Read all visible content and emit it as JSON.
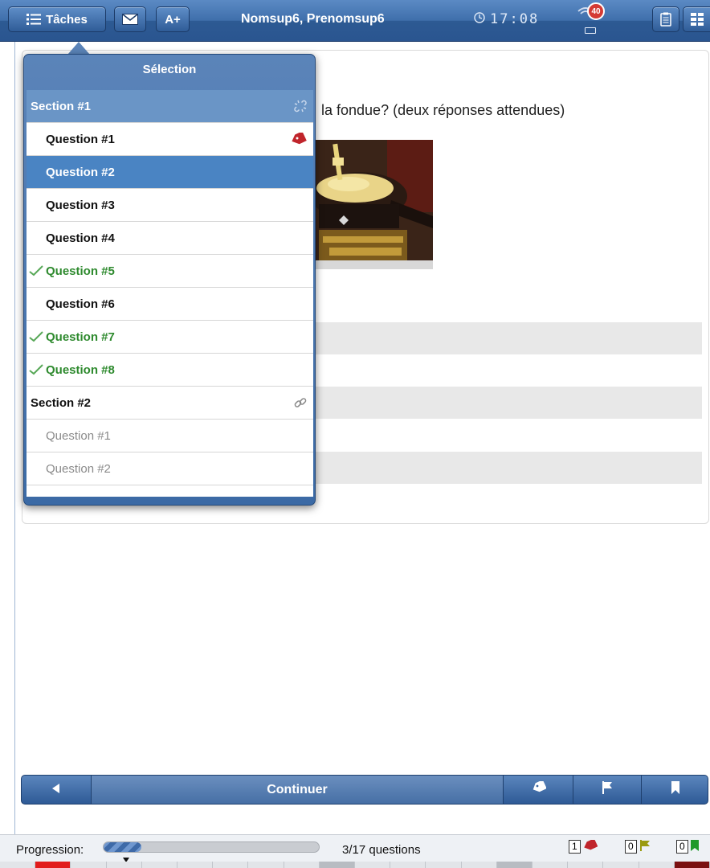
{
  "header": {
    "tasks_label": "Tâches",
    "font_button_label": "A+",
    "student_name": "Nomsup6, Prenomsup6",
    "time": "17:08",
    "notification_count": "40"
  },
  "question": {
    "text_visible": "la fondue? (deux réponses attendues)"
  },
  "selection_panel": {
    "title": "Sélection",
    "rows": [
      {
        "label": "Section #1",
        "kind": "section",
        "state": "current-section",
        "icon": "link-broken-icon"
      },
      {
        "label": "Question #1",
        "kind": "question",
        "state": "normal",
        "icon": "tag-icon"
      },
      {
        "label": "Question #2",
        "kind": "question",
        "state": "selected",
        "icon": ""
      },
      {
        "label": "Question #3",
        "kind": "question",
        "state": "normal",
        "icon": ""
      },
      {
        "label": "Question #4",
        "kind": "question",
        "state": "normal",
        "icon": ""
      },
      {
        "label": "Question #5",
        "kind": "question",
        "state": "done",
        "icon": "check-icon"
      },
      {
        "label": "Question #6",
        "kind": "question",
        "state": "normal",
        "icon": ""
      },
      {
        "label": "Question #7",
        "kind": "question",
        "state": "done",
        "icon": "check-icon"
      },
      {
        "label": "Question #8",
        "kind": "question",
        "state": "done",
        "icon": "check-icon"
      },
      {
        "label": "Section #2",
        "kind": "section",
        "state": "normal",
        "icon": "link-icon"
      },
      {
        "label": "Question #1",
        "kind": "question",
        "state": "disabled",
        "icon": ""
      },
      {
        "label": "Question #2",
        "kind": "question",
        "state": "disabled",
        "icon": ""
      }
    ]
  },
  "navigation": {
    "continue_label": "Continuer"
  },
  "status_bar": {
    "progress_label": "Progression:",
    "progress_fraction": 0.176,
    "progress_text": "3/17 questions",
    "tag_count": "1",
    "flag_count": "0",
    "bookmark_count": "0"
  },
  "colors": {
    "accent": "#3f6fab",
    "selected_row": "#4a84c3",
    "done_text": "#2e8a2e",
    "tag_red": "#c0242b",
    "flag_olive": "#9a9a10",
    "bookmark_green": "#1f9a2a"
  }
}
